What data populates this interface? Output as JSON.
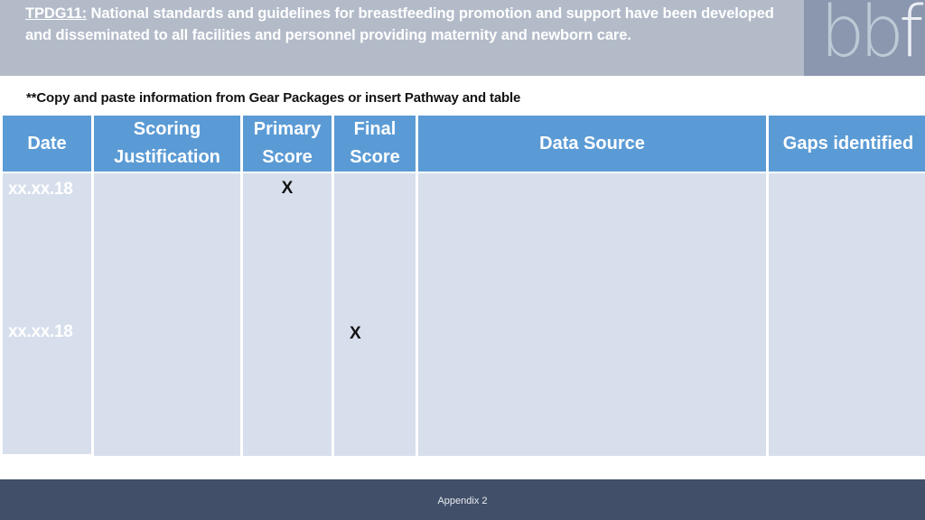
{
  "banner": {
    "code": "TPDG11:",
    "text": " National standards and guidelines for breastfeeding promotion and support have been developed and disseminated to all facilities and personnel providing maternity and newborn care.",
    "background_color": "#b3bbc9",
    "text_color": "#ffffff"
  },
  "logo": {
    "mark_first": "bb",
    "mark_last": "f",
    "alt": "bbf",
    "panel_color": "#8a97ae"
  },
  "instruction": {
    "text": "**Copy and paste information from Gear Packages or insert Pathway and table"
  },
  "table": {
    "header_color": "#5b9bd5",
    "body_color": "#d7dfec",
    "columns": [
      {
        "label": "Date"
      },
      {
        "label": "Scoring Justification"
      },
      {
        "label": "Primary Score"
      },
      {
        "label": "Final Score"
      },
      {
        "label": "Data Source"
      },
      {
        "label": "Gaps identified"
      }
    ],
    "rows": [
      {
        "date": "xx.xx.18",
        "scoring_justification": "",
        "primary_score": "X",
        "final_score": "",
        "data_source": "",
        "gaps_identified": ""
      },
      {
        "date": "xx.xx.18",
        "scoring_justification": "",
        "primary_score": "",
        "final_score": "X",
        "data_source": "",
        "gaps_identified": ""
      }
    ]
  },
  "footer": {
    "label": "Appendix 2",
    "background_color": "#414f68"
  }
}
